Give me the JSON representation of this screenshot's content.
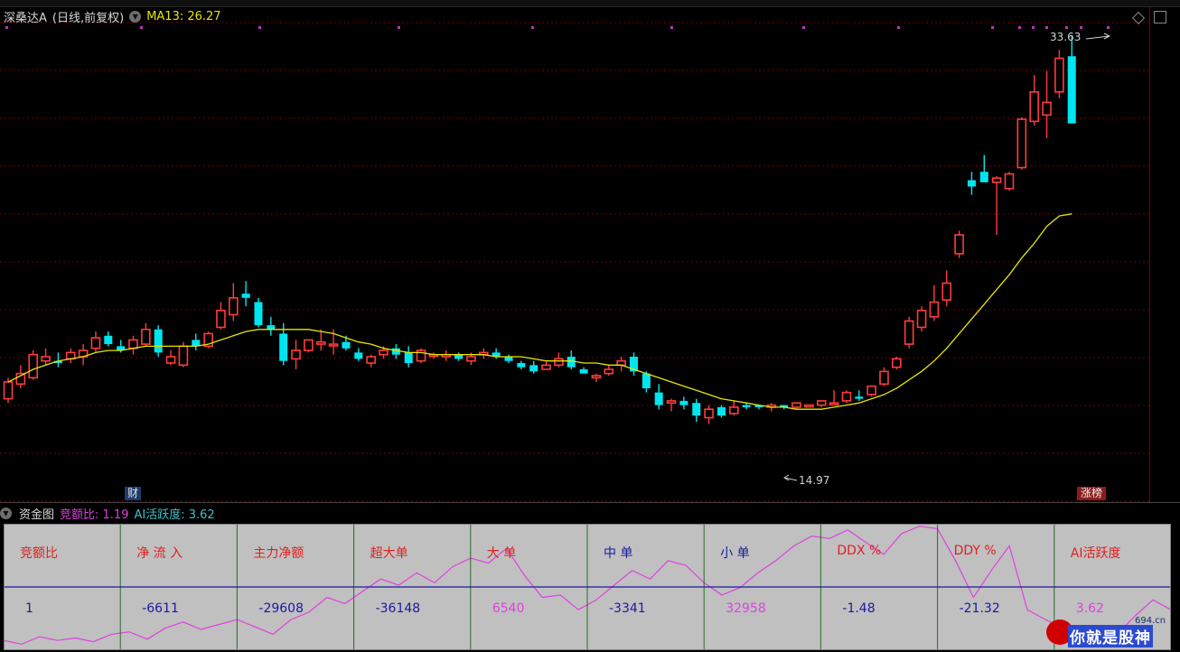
{
  "header": {
    "stock_name": "深桑达A",
    "mode": "(日线,前复权)",
    "ma_label": "MA13: 26.27"
  },
  "chart_data": {
    "type": "candlestick",
    "ylim": [
      13.5,
      35.5
    ],
    "ohlc": [
      [
        17.6,
        18.6,
        17.4,
        18.4
      ],
      [
        18.3,
        19.2,
        18.1,
        18.8
      ],
      [
        18.6,
        19.9,
        18.5,
        19.7
      ],
      [
        19.4,
        20.0,
        19.2,
        19.6
      ],
      [
        19.4,
        19.8,
        19.1,
        19.3
      ],
      [
        19.5,
        20.0,
        19.3,
        19.8
      ],
      [
        19.6,
        20.2,
        19.2,
        19.9
      ],
      [
        20.0,
        20.8,
        19.8,
        20.5
      ],
      [
        20.6,
        20.8,
        20.1,
        20.2
      ],
      [
        20.1,
        20.4,
        19.8,
        19.9
      ],
      [
        20.0,
        20.6,
        19.7,
        20.4
      ],
      [
        20.2,
        21.2,
        20.1,
        20.9
      ],
      [
        20.9,
        21.1,
        19.6,
        19.8
      ],
      [
        19.3,
        19.9,
        19.2,
        19.6
      ],
      [
        19.2,
        20.3,
        19.1,
        20.1
      ],
      [
        20.4,
        20.7,
        19.9,
        20.1
      ],
      [
        20.1,
        20.8,
        20.0,
        20.7
      ],
      [
        21.0,
        22.2,
        20.9,
        21.8
      ],
      [
        21.6,
        23.1,
        21.3,
        22.4
      ],
      [
        22.6,
        23.2,
        22.0,
        22.4
      ],
      [
        22.2,
        22.4,
        21.0,
        21.1
      ],
      [
        21.1,
        21.5,
        20.6,
        20.9
      ],
      [
        20.7,
        21.2,
        19.2,
        19.4
      ],
      [
        19.5,
        20.4,
        19.0,
        19.9
      ],
      [
        19.9,
        20.4,
        19.8,
        20.4
      ],
      [
        20.2,
        20.9,
        19.9,
        20.3
      ],
      [
        20.2,
        20.9,
        19.7,
        20.2
      ],
      [
        20.3,
        20.6,
        19.9,
        20.0
      ],
      [
        19.8,
        20.0,
        19.4,
        19.5
      ],
      [
        19.3,
        19.7,
        19.1,
        19.6
      ],
      [
        19.7,
        20.1,
        19.5,
        19.9
      ],
      [
        20.0,
        20.2,
        19.5,
        19.7
      ],
      [
        19.8,
        20.1,
        19.1,
        19.3
      ],
      [
        19.4,
        20.0,
        19.3,
        19.9
      ],
      [
        19.7,
        19.8,
        19.5,
        19.7
      ],
      [
        19.6,
        19.9,
        19.4,
        19.7
      ],
      [
        19.7,
        19.8,
        19.4,
        19.5
      ],
      [
        19.4,
        19.8,
        19.2,
        19.6
      ],
      [
        19.7,
        20.0,
        19.5,
        19.8
      ],
      [
        19.8,
        20.0,
        19.5,
        19.6
      ],
      [
        19.6,
        19.7,
        19.3,
        19.4
      ],
      [
        19.3,
        19.4,
        19.0,
        19.1
      ],
      [
        19.2,
        19.4,
        18.8,
        18.9
      ],
      [
        19.0,
        19.4,
        19.0,
        19.2
      ],
      [
        19.2,
        19.8,
        19.1,
        19.5
      ],
      [
        19.6,
        19.9,
        19.0,
        19.1
      ],
      [
        19.0,
        19.1,
        18.8,
        18.8
      ],
      [
        18.6,
        18.8,
        18.4,
        18.7
      ],
      [
        18.8,
        19.2,
        18.7,
        19.0
      ],
      [
        19.2,
        19.6,
        18.9,
        19.4
      ],
      [
        19.6,
        19.8,
        18.7,
        18.9
      ],
      [
        18.8,
        18.9,
        17.9,
        18.1
      ],
      [
        17.9,
        18.3,
        17.1,
        17.3
      ],
      [
        17.4,
        17.6,
        17.0,
        17.5
      ],
      [
        17.5,
        17.7,
        17.1,
        17.3
      ],
      [
        17.4,
        17.6,
        16.5,
        16.8
      ],
      [
        16.7,
        17.3,
        16.4,
        17.1
      ],
      [
        17.2,
        17.3,
        16.7,
        16.8
      ],
      [
        16.9,
        17.5,
        16.8,
        17.2
      ],
      [
        17.3,
        17.4,
        17.1,
        17.2
      ],
      [
        17.3,
        17.3,
        17.1,
        17.2
      ],
      [
        17.2,
        17.4,
        17.0,
        17.3
      ],
      [
        17.3,
        17.3,
        17.1,
        17.2
      ],
      [
        17.2,
        17.4,
        17.1,
        17.4
      ],
      [
        17.3,
        17.3,
        17.2,
        17.3
      ],
      [
        17.3,
        17.5,
        17.2,
        17.5
      ],
      [
        17.4,
        18.0,
        17.3,
        17.4
      ],
      [
        17.5,
        18.0,
        17.4,
        17.9
      ],
      [
        17.7,
        18.0,
        17.5,
        17.6
      ],
      [
        17.8,
        18.2,
        17.7,
        18.2
      ],
      [
        18.3,
        19.1,
        18.2,
        18.9
      ],
      [
        19.1,
        19.6,
        19.0,
        19.5
      ],
      [
        20.2,
        21.5,
        20.0,
        21.3
      ],
      [
        21.0,
        22.0,
        20.8,
        21.8
      ],
      [
        21.5,
        23.0,
        21.3,
        22.2
      ],
      [
        22.3,
        23.7,
        22.0,
        23.1
      ],
      [
        24.5,
        25.6,
        24.3,
        25.4
      ],
      [
        28.0,
        28.4,
        27.3,
        27.7
      ],
      [
        28.4,
        29.2,
        28.2,
        27.9
      ],
      [
        27.9,
        28.2,
        25.4,
        28.1
      ],
      [
        27.6,
        28.4,
        27.5,
        28.3
      ],
      [
        28.6,
        31.0,
        28.5,
        30.9
      ],
      [
        30.8,
        33.0,
        30.6,
        32.2
      ],
      [
        31.1,
        33.2,
        30.0,
        31.7
      ],
      [
        32.2,
        34.2,
        31.9,
        33.8
      ],
      [
        33.9,
        34.9,
        32.0,
        30.7
      ]
    ],
    "ma13": [
      18.4,
      18.7,
      19.0,
      19.2,
      19.4,
      19.5,
      19.6,
      19.8,
      19.9,
      19.9,
      20.0,
      20.1,
      20.1,
      20.1,
      20.1,
      20.1,
      20.2,
      20.4,
      20.6,
      20.8,
      20.9,
      20.9,
      20.9,
      20.9,
      20.9,
      20.8,
      20.7,
      20.5,
      20.3,
      20.2,
      20.0,
      19.9,
      19.8,
      19.8,
      19.7,
      19.7,
      19.7,
      19.7,
      19.7,
      19.6,
      19.6,
      19.6,
      19.5,
      19.4,
      19.4,
      19.4,
      19.3,
      19.3,
      19.2,
      19.2,
      19.0,
      18.8,
      18.6,
      18.4,
      18.2,
      18.0,
      17.8,
      17.6,
      17.5,
      17.4,
      17.3,
      17.2,
      17.2,
      17.1,
      17.1,
      17.1,
      17.2,
      17.3,
      17.4,
      17.6,
      17.8,
      18.1,
      18.5,
      18.9,
      19.4,
      20.0,
      20.7,
      21.4,
      22.1,
      22.8,
      23.5,
      24.3,
      25.0,
      25.8,
      26.3,
      26.4
    ],
    "high_label": "33.63",
    "low_label": "14.97",
    "badge_cai": "财",
    "badge_zhangbang": "涨榜",
    "colors": {
      "up": "#ff3c3c",
      "down": "#00e6f0",
      "ma": "#e6e600",
      "grid": "#7a0000"
    },
    "indicator_line": [
      0.05,
      0.02,
      0.08,
      0.05,
      0.07,
      0.04,
      0.1,
      0.12,
      0.06,
      0.15,
      0.2,
      0.14,
      0.18,
      0.22,
      0.16,
      0.1,
      0.22,
      0.28,
      0.4,
      0.35,
      0.45,
      0.55,
      0.5,
      0.6,
      0.52,
      0.65,
      0.72,
      0.68,
      0.8,
      0.58,
      0.4,
      0.42,
      0.3,
      0.38,
      0.5,
      0.62,
      0.55,
      0.7,
      0.66,
      0.52,
      0.42,
      0.48,
      0.6,
      0.7,
      0.82,
      0.9,
      0.88,
      0.95,
      0.85,
      0.75,
      0.92,
      0.98,
      0.96,
      0.7,
      0.4,
      0.62,
      0.82,
      0.3,
      0.22,
      0.15,
      0.06,
      0.02,
      0.1,
      0.25,
      0.38,
      0.3
    ]
  },
  "fund": {
    "name": "资金图",
    "ratio": "竞额比: 1.19",
    "ai": "AI活跃度: 3.62"
  },
  "table": {
    "headers": [
      "竞额比",
      "净 流 入",
      "主力净额",
      "超大单",
      "大 单",
      "中 单",
      "小 单",
      "DDX %",
      "DDY %",
      "AI活跃度"
    ],
    "values": [
      "1",
      "-6611",
      "-29608",
      "-36148",
      "6540",
      "-3341",
      "32958",
      "-1.48",
      "-21.32",
      "3.62"
    ],
    "header_colors": [
      "#e02020",
      "#e02020",
      "#e02020",
      "#e02020",
      "#e02020",
      "#1a1aa0",
      "#1a1aa0",
      "#e02020",
      "#e02020",
      "#e02020"
    ],
    "value_colors": [
      "#1a1aa0",
      "#1a1aa0",
      "#1a1aa0",
      "#1a1aa0",
      "#e040e0",
      "#1a1aa0",
      "#e040e0",
      "#1a1aa0",
      "#1a1aa0",
      "#e040e0"
    ]
  },
  "watermark": {
    "site": "694.cn",
    "brand": "你就是股神"
  }
}
